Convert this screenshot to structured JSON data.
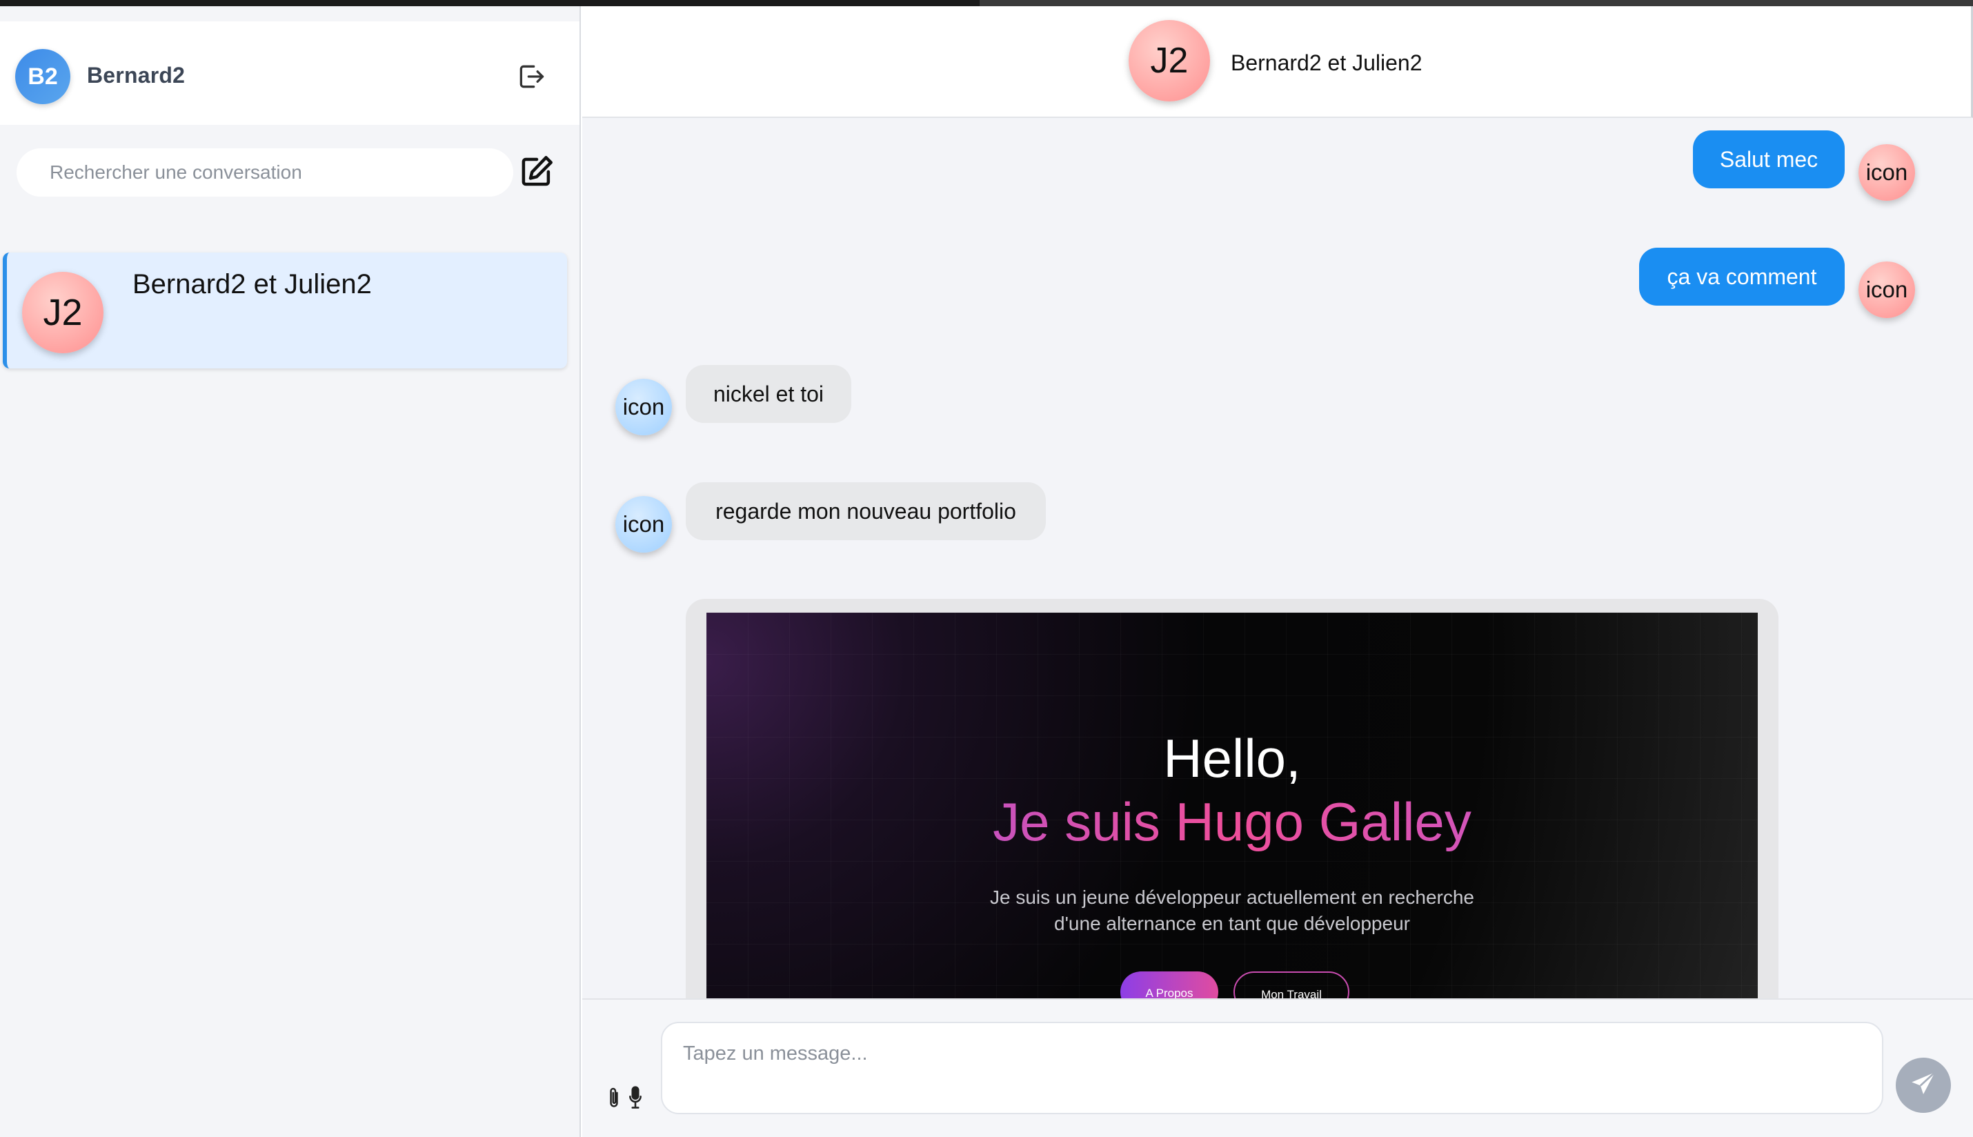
{
  "user": {
    "initials": "B2",
    "name": "Bernard2"
  },
  "sidebar": {
    "search_placeholder": "Rechercher une conversation",
    "conversations": [
      {
        "initials": "J2",
        "title": "Bernard2 et Julien2",
        "active": true
      }
    ]
  },
  "chat": {
    "header": {
      "initials": "J2",
      "title": "Bernard2 et Julien2"
    },
    "messages": [
      {
        "direction": "outgoing",
        "text": "Salut mec",
        "avatar_label": "icon"
      },
      {
        "direction": "outgoing",
        "text": "ça va comment",
        "avatar_label": "icon"
      },
      {
        "direction": "incoming",
        "text": "nickel et toi",
        "avatar_label": "icon"
      },
      {
        "direction": "incoming",
        "text": "regarde mon nouveau portfolio",
        "avatar_label": "icon"
      }
    ],
    "portfolio_preview": {
      "hello": "Hello,",
      "name": "Je suis Hugo Galley",
      "desc_line1": "Je suis un jeune développeur actuellement en recherche",
      "desc_line2": "d'une alternance en tant que développeur",
      "button1": "A Propos",
      "button2": "Mon Travail"
    }
  },
  "composer": {
    "placeholder": "Tapez un message..."
  },
  "icons": {
    "logout": "logout-icon",
    "compose": "compose-icon",
    "attach": "paperclip-icon",
    "mic": "microphone-icon",
    "send": "send-icon"
  },
  "colors": {
    "accent": "#1a8ef2",
    "incoming_bubble": "#e7e8ea",
    "active_conversation": "#e3efff",
    "send_button": "#a6aebb"
  }
}
